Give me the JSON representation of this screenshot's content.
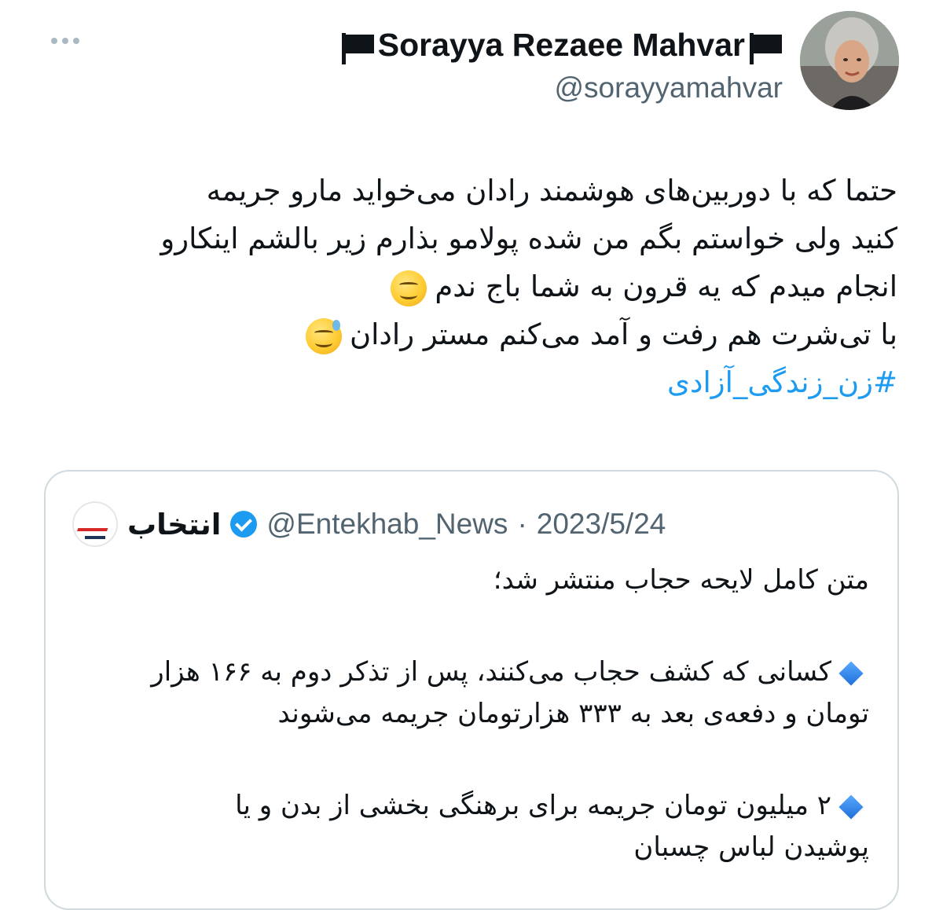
{
  "author": {
    "display_name": "Sorayya Rezaee Mahvar",
    "handle": "@sorayyamahvar"
  },
  "tweet": {
    "lines": [
      "حتما که با دوربین‌های هوشمند رادان می‌خواید مارو جریمه",
      "کنید ولی خواستم بگم من شده پولامو بذارم زیر بالشم اینکارو",
      "انجام میدم که یه قرون به شما باج ندم",
      "با تی‌شرت هم رفت و آمد می‌کنم مستر رادان"
    ],
    "hashtag": "#زن_زندگی_آزادی"
  },
  "quote": {
    "author_name": "انتخاب",
    "handle": "@Entekhab_News",
    "separator": "·",
    "date": "2023/5/24",
    "title": "متن کامل لایحه حجاب منتشر شد؛",
    "bullet1": [
      "کسانی که کشف حجاب می‌کنند، پس از تذکر دوم به ۱۶۶ هزار",
      "تومان و دفعه‌ی بعد به ۳۳۳ هزارتومان جریمه می‌شوند"
    ],
    "bullet2": [
      "۲ میلیون تومان جریمه برای برهنگی بخشی از بدن و یا",
      "پوشیدن لباس چسبان"
    ]
  },
  "icons": {
    "more": "more-icon",
    "flag": "black-flag-icon",
    "verified": "verified-icon",
    "bullet": "blue-diamond-icon",
    "emoji_smirk": "smirking-face-emoji",
    "emoji_sweat": "grinning-sweat-emoji"
  },
  "colors": {
    "link": "#1d9bf0",
    "secondary_text": "#536471",
    "border": "#cfd9de"
  }
}
